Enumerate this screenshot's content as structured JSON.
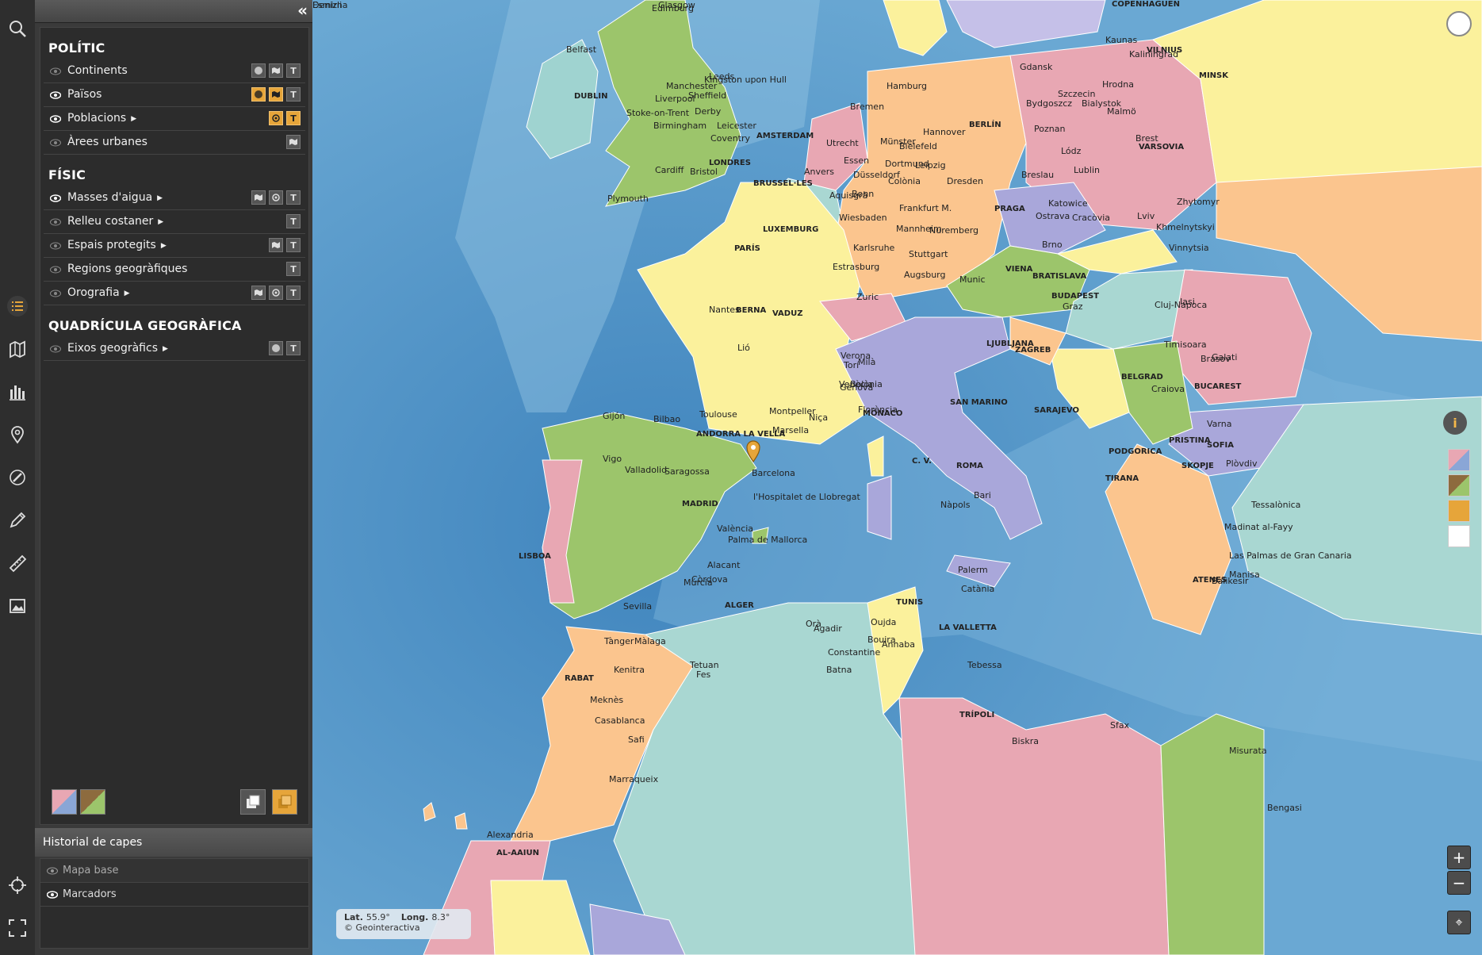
{
  "panel": {
    "collapse_label": "«",
    "sections": [
      {
        "title": "POLÍTIC",
        "rows": [
          {
            "label": "Continents",
            "arrow": false,
            "visible": false,
            "buttons": [
              "globe",
              "map",
              "T"
            ]
          },
          {
            "label": "Països",
            "arrow": false,
            "visible": true,
            "buttons": [
              "globe-on",
              "map-on",
              "T"
            ]
          },
          {
            "label": "Poblacions",
            "arrow": true,
            "visible": true,
            "buttons": [
              "circle-on",
              "T-on"
            ]
          },
          {
            "label": "Àrees urbanes",
            "arrow": false,
            "visible": false,
            "buttons": [
              "map"
            ]
          }
        ]
      },
      {
        "title": "FÍSIC",
        "rows": [
          {
            "label": "Masses d'aigua",
            "arrow": true,
            "visible": true,
            "buttons": [
              "map",
              "circle",
              "T"
            ]
          },
          {
            "label": "Relleu costaner",
            "arrow": true,
            "visible": false,
            "buttons": [
              "T"
            ]
          },
          {
            "label": "Espais protegits",
            "arrow": true,
            "visible": false,
            "buttons": [
              "map",
              "T"
            ]
          },
          {
            "label": "Regions geogràfiques",
            "arrow": false,
            "visible": false,
            "buttons": [
              "T"
            ]
          },
          {
            "label": "Orografia",
            "arrow": true,
            "visible": false,
            "buttons": [
              "map",
              "circle",
              "T"
            ]
          }
        ]
      },
      {
        "title": "QUADRÍCULA GEOGRÀFICA",
        "rows": [
          {
            "label": "Eixos geogràfics",
            "arrow": true,
            "visible": false,
            "buttons": [
              "globe",
              "T"
            ]
          }
        ]
      }
    ],
    "history_title": "Historial de capes",
    "history": [
      {
        "label": "Mapa base",
        "dim": true
      },
      {
        "label": "Marcadors",
        "dim": false
      }
    ]
  },
  "coords": {
    "lat_label": "Lat.",
    "lat": "55.9°",
    "lon_label": "Long.",
    "lon": "8.3°",
    "credit": "© Geointeractiva"
  },
  "map_labels": {
    "capitals": [
      "DUBLIN",
      "LONDRES",
      "AMSTERDAM",
      "BRUSSEL·LES",
      "LUXEMBURG",
      "PARÍS",
      "BERLÍN",
      "PRAGA",
      "VIENA",
      "BRATISLAVA",
      "BUDAPEST",
      "VARSOVIA",
      "VILNIUS",
      "MINSK",
      "COPENHAGUEN",
      "BERNA",
      "VADUZ",
      "LJUBLJANA",
      "ZAGREB",
      "SARAJEVO",
      "BELGRAD",
      "BUCAREST",
      "SOFIA",
      "PRISTINA",
      "SKOPJE",
      "PODGORICA",
      "TIRANA",
      "ATENES",
      "ROMA",
      "SAN MARINO",
      "C. V.",
      "MÒNACO",
      "ANDORRA LA VELLA",
      "MADRID",
      "LISBOA",
      "RABAT",
      "ALGER",
      "TUNIS",
      "LA VALLETTA",
      "TRÍPOLI",
      "AL-AAIUN"
    ],
    "cities": [
      "Glasgow",
      "Edimburg",
      "Belfast",
      "Leeds",
      "Manchester",
      "Liverpool",
      "Sheffield",
      "Kingston upon Hull",
      "Stoke-on-Trent",
      "Derby",
      "Birmingham",
      "Leicester",
      "Coventry",
      "Cardiff",
      "Bristol",
      "Plymouth",
      "Hamburg",
      "Bremen",
      "Hannover",
      "Münster",
      "Bielefeld",
      "Essen",
      "Dortmund",
      "Utrecht",
      "Düsseldorf",
      "Colònia",
      "Anvers",
      "Aquisgrà",
      "Bonn",
      "Leipzig",
      "Dresden",
      "Frankfurt M.",
      "Wiesbaden",
      "Mannheim",
      "Nuremberg",
      "Karlsruhe",
      "Stuttgart",
      "Estrasburg",
      "Augsburg",
      "Munic",
      "Zuric",
      "Gdansk",
      "Szczecin",
      "Bydgoszcz",
      "Poznan",
      "Lódz",
      "Bialystok",
      "Hrodna",
      "Kaunas",
      "Kaliningrad",
      "Breslau",
      "Lublin",
      "Brest",
      "Katowice",
      "Ostrava",
      "Cracòvia",
      "Brno",
      "Graz",
      "Lviv",
      "Zhytomyr",
      "Khmelnytskyi",
      "Vinnytsia",
      "Cluj-Napoca",
      "Iasi",
      "Timisoara",
      "Brasov",
      "Galati",
      "Craiova",
      "Varna",
      "Plòvdiv",
      "Tessalònica",
      "Malmö",
      "Nantes",
      "Lió",
      "Toulouse",
      "Montpeller",
      "Marsella",
      "Niça",
      "Torí",
      "Milà",
      "Gènova",
      "Verona",
      "Venècia",
      "Bolònia",
      "Florència",
      "Nàpols",
      "Bari",
      "Palerm",
      "Catània",
      "Gijón",
      "Bilbao",
      "Vigo",
      "Valladolid",
      "Saragossa",
      "Barcelona",
      "l'Hospitalet de Llobregat",
      "València",
      "Palma de Mallorca",
      "Alacant",
      "Múrcia",
      "Còrdova",
      "Sevilla",
      "Màlaga",
      "Tànger",
      "Tetuan",
      "Kenitra",
      "Fes",
      "Meknès",
      "Casablanca",
      "Safi",
      "Marraqueix",
      "Agadir",
      "Orà",
      "Oujda",
      "Bouira",
      "Annaba",
      "Constantine",
      "Batna",
      "Tebessa",
      "Biskra",
      "Sfax",
      "Misurata",
      "Bengasi",
      "Alexandria",
      "Madinat al-Fayy",
      "Las Palmas de Gran Canaria",
      "Balikesir",
      "Manisa",
      "Esmirna",
      "Denizli"
    ]
  },
  "colors": {
    "accent": "#e6a53a",
    "sea": "#5a9bc9",
    "toolbar": "#2e2e2e",
    "panel": "#2c2c2c"
  }
}
